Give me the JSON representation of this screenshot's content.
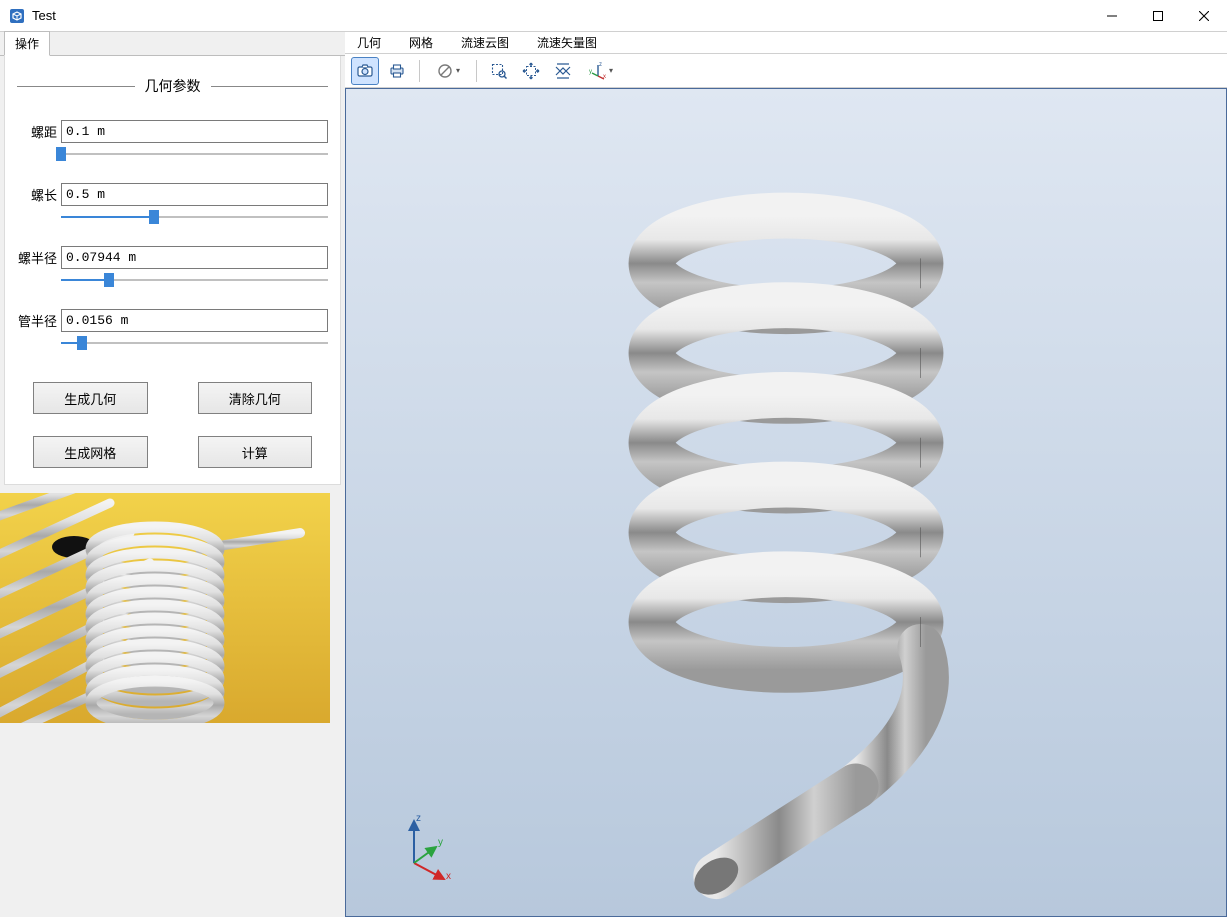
{
  "window": {
    "title": "Test"
  },
  "left_panel": {
    "ops_tab_label": "操作",
    "section_title": "几何参数",
    "params": {
      "pitch": {
        "label": "螺距",
        "value": "0.1 m",
        "slider_pct": 0
      },
      "length": {
        "label": "螺长",
        "value": "0.5 m",
        "slider_pct": 35
      },
      "h_radius": {
        "label": "螺半径",
        "value": "0.07944 m",
        "slider_pct": 18
      },
      "t_radius": {
        "label": "管半径",
        "value": "0.0156 m",
        "slider_pct": 8
      }
    },
    "buttons": {
      "gen_geom": "生成几何",
      "clear_geom": "清除几何",
      "gen_mesh": "生成网格",
      "compute": "计算"
    }
  },
  "view_tabs": {
    "geometry": "几何",
    "mesh": "网格",
    "vel_cloud": "流速云图",
    "vel_vector": "流速矢量图"
  },
  "toolbar_icons": {
    "camera": "camera-icon",
    "print": "print-icon",
    "disable": "disable-icon",
    "zoom_sel": "zoom-select-icon",
    "pan": "pan-icon",
    "fit": "fit-view-icon",
    "axes": "axes-orient-icon"
  },
  "triad": {
    "x_label": "x",
    "y_label": "y",
    "z_label": "z"
  }
}
